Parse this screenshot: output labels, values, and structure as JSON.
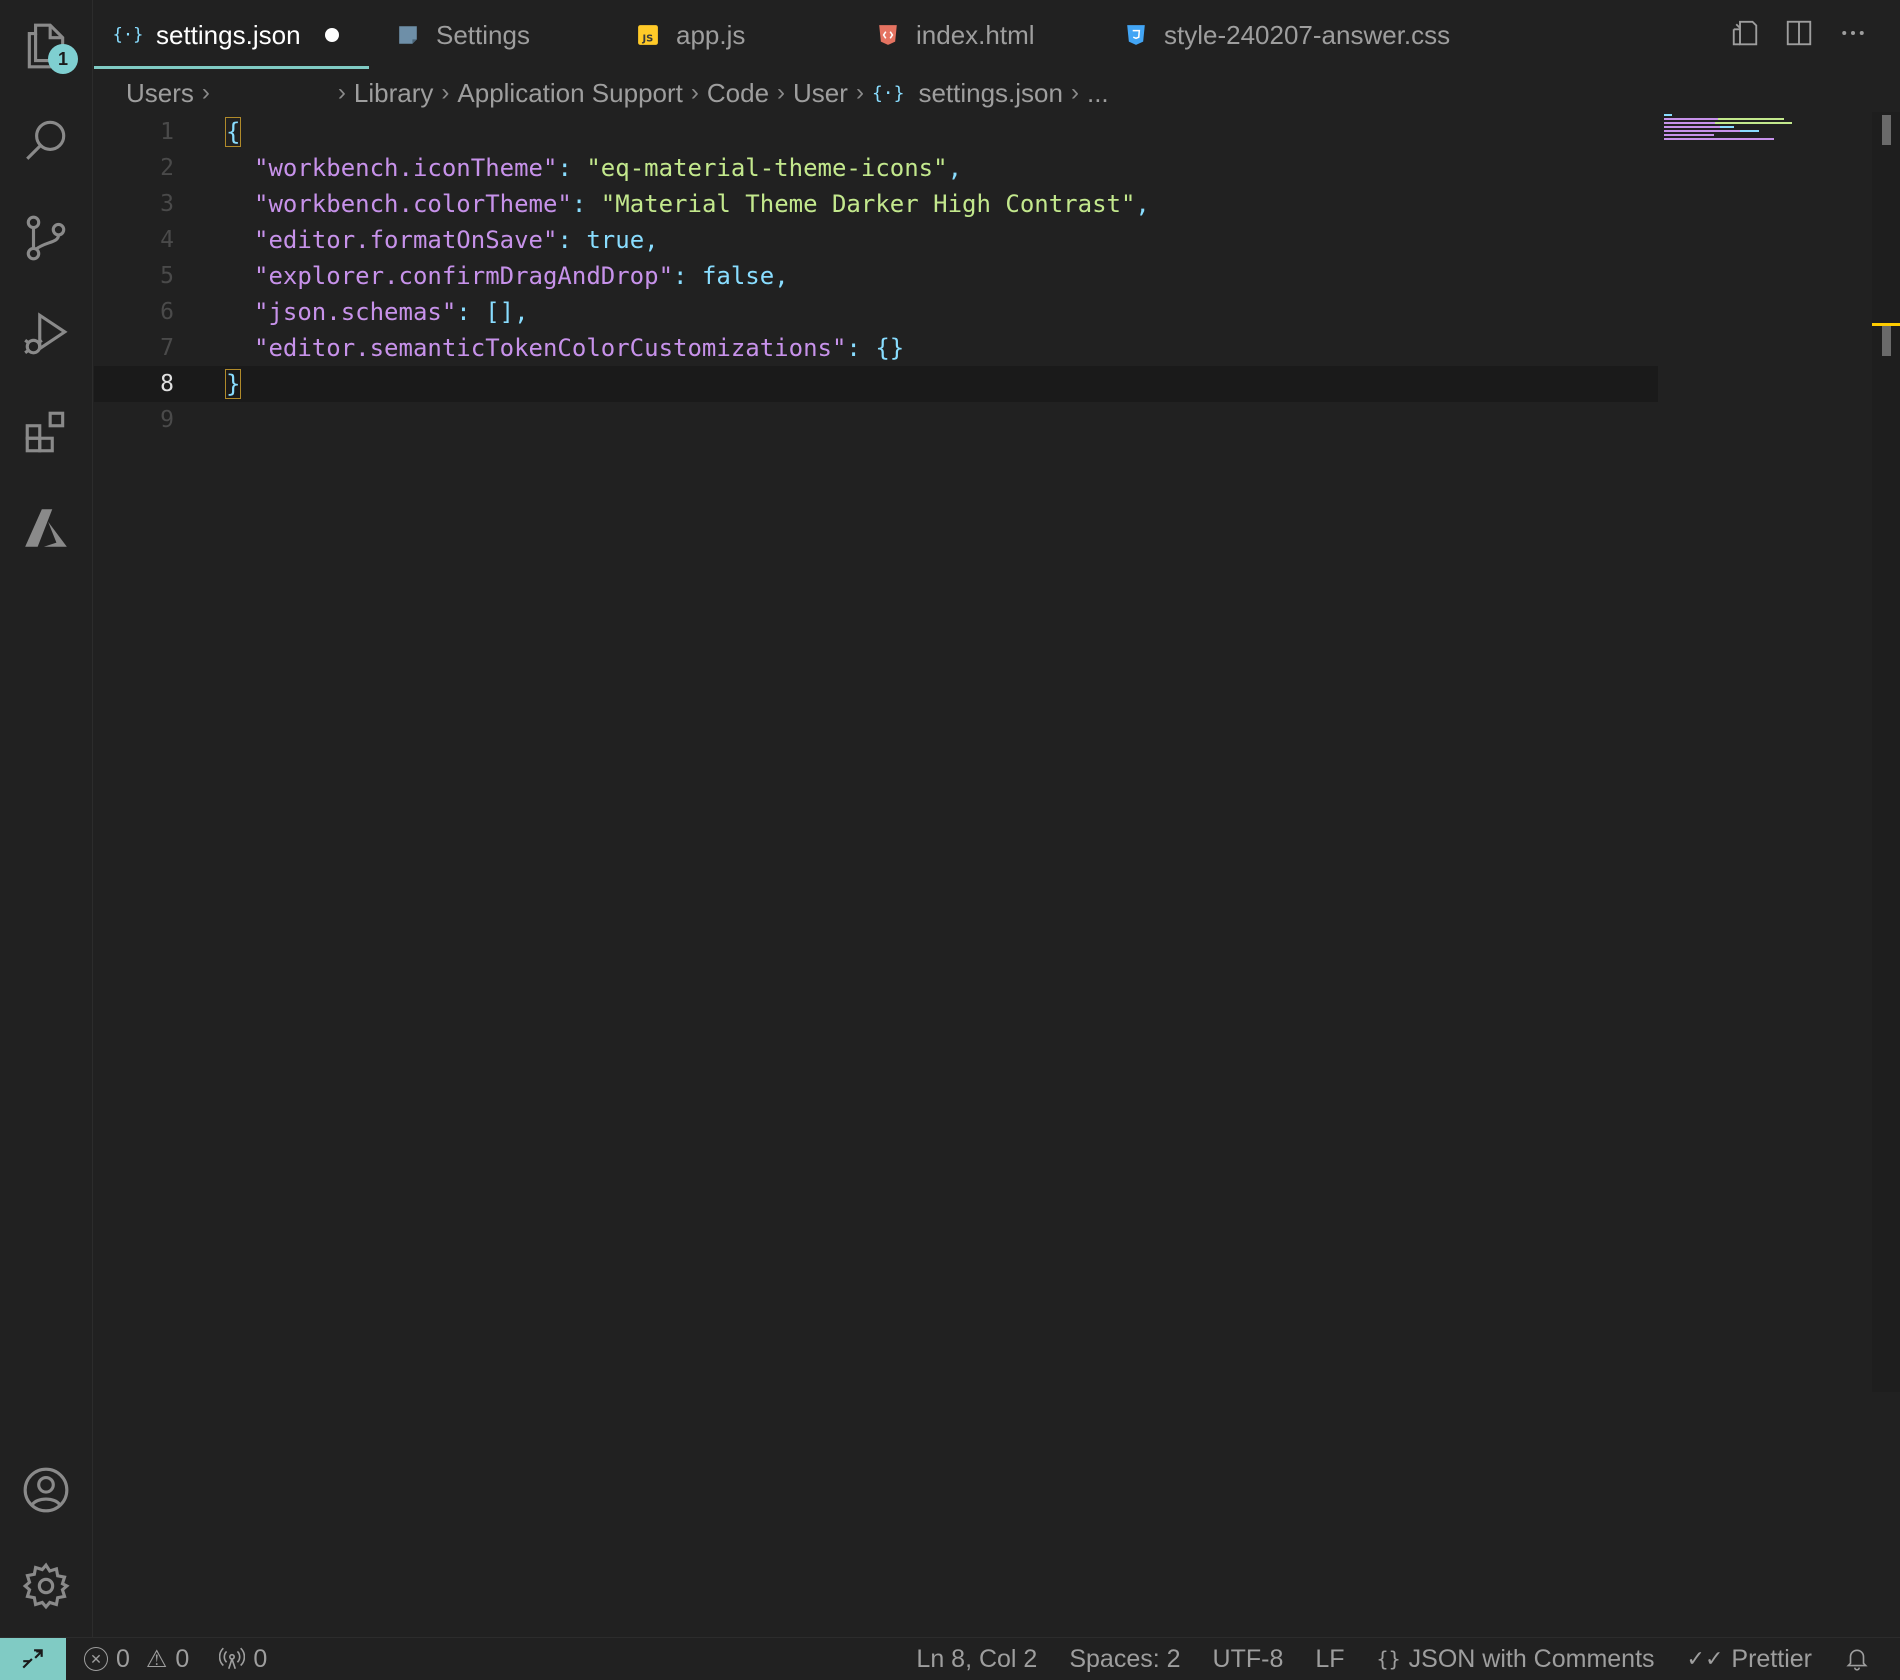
{
  "activity_bar": {
    "explorer_badge": "1",
    "items": [
      "explorer-icon",
      "search-icon",
      "source-control-icon",
      "run-debug-icon",
      "extensions-icon",
      "azure-icon"
    ],
    "bottom": [
      "account-icon",
      "settings-gear-icon"
    ]
  },
  "tabs": [
    {
      "label": "settings.json",
      "icon": "json-braces-icon",
      "active": true,
      "dirty": true
    },
    {
      "label": "Settings",
      "icon": "settings-file-icon"
    },
    {
      "label": "app.js",
      "icon": "js-icon"
    },
    {
      "label": "index.html",
      "icon": "html-icon"
    },
    {
      "label": "style-240207-answer.css",
      "icon": "css-icon"
    }
  ],
  "breadcrumb": {
    "items": [
      "Users",
      "Library",
      "Application Support",
      "Code",
      "User",
      "settings.json",
      "..."
    ]
  },
  "editor": {
    "lines": [
      {
        "n": "1"
      },
      {
        "n": "2",
        "key": "\"workbench.iconTheme\"",
        "value": "\"eq-material-theme-icons\""
      },
      {
        "n": "3",
        "key": "\"workbench.colorTheme\"",
        "value": "\"Material Theme Darker High Contrast\""
      },
      {
        "n": "4",
        "key": "\"editor.formatOnSave\"",
        "value": "true"
      },
      {
        "n": "5",
        "key": "\"explorer.confirmDragAndDrop\"",
        "value": "false"
      },
      {
        "n": "6",
        "key": "\"json.schemas\"",
        "value": "[]"
      },
      {
        "n": "7",
        "key": "\"editor.semanticTokenColorCustomizations\"",
        "value": "{}"
      },
      {
        "n": "8"
      },
      {
        "n": "9"
      }
    ],
    "open_brace": "{",
    "close_brace": "}",
    "colon": ": ",
    "comma": ","
  },
  "status": {
    "errors": "0",
    "warnings": "0",
    "ports": "0",
    "position": "Ln 8, Col 2",
    "spaces": "Spaces: 2",
    "encoding": "UTF-8",
    "eol": "LF",
    "language": "JSON with Comments",
    "formatter": "Prettier"
  },
  "colors": {
    "accent": "#80cbc4",
    "key": "#c792ea",
    "string": "#c3e88d",
    "punctuation": "#89ddff",
    "background": "#212121"
  }
}
